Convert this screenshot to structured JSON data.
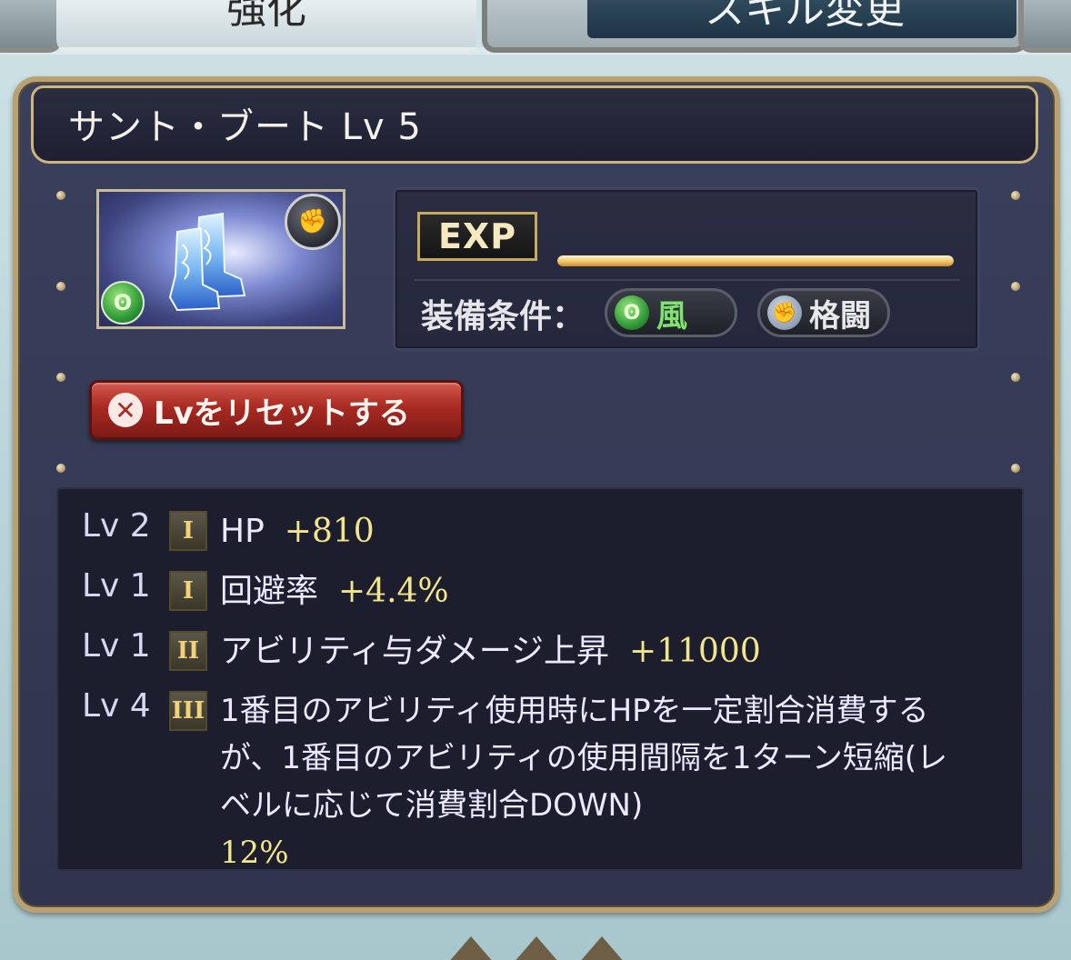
{
  "tabs": [
    {
      "label": "強化",
      "active": true
    },
    {
      "label": "スキル変更",
      "active": false
    }
  ],
  "item": {
    "name": "サント・ブート",
    "level_label": "Lv 5",
    "title": "サント・ブート Lv 5",
    "element_icon": "wind-element-icon",
    "weapon_icon": "fist-weapon-icon"
  },
  "exp": {
    "label": "EXP",
    "progress": 1.0
  },
  "equip": {
    "label": "装備条件：",
    "conditions": [
      {
        "icon": "wind-icon",
        "label": "風"
      },
      {
        "icon": "fist-icon",
        "label": "格闘"
      }
    ]
  },
  "reset_button": {
    "label": "Lvをリセットする",
    "icon": "close-icon"
  },
  "skills": [
    {
      "lv": "Lv 2",
      "tier": "I",
      "name": "HP",
      "value": "+810"
    },
    {
      "lv": "Lv 1",
      "tier": "I",
      "name": "回避率",
      "value": "+4.4%"
    },
    {
      "lv": "Lv 1",
      "tier": "II",
      "name": "アビリティ与ダメージ上昇",
      "value": "+11000"
    },
    {
      "lv": "Lv 4",
      "tier": "III",
      "name": "1番目のアビリティ使用時にHPを一定割合消費するが、1番目のアビリティの使用間隔を1ターン短縮(レベルに応じて消費割合DOWN)",
      "value": "12%"
    }
  ],
  "colors": {
    "panel_border": "#b8a173",
    "value_text": "#f3e58c",
    "reset_button": "#a82a22"
  }
}
